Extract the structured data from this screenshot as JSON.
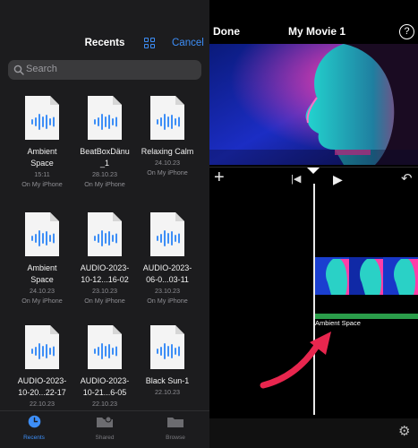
{
  "imovie": {
    "done_label": "Done",
    "title": "My Movie 1",
    "help_icon": "?",
    "audio_clip_label": "Ambient Space",
    "colors": {
      "audio_track": "#2a9d4a"
    }
  },
  "files": {
    "title": "Recents",
    "cancel_label": "Cancel",
    "search_placeholder": "Search",
    "accent": "#3d8ef7",
    "items": [
      {
        "name_line1": "Ambient",
        "name_line2": "Space",
        "meta": "15:11",
        "location": "On My iPhone"
      },
      {
        "name_line1": "BeatBoxDänu",
        "name_line2": "_1",
        "meta": "28.10.23",
        "location": "On My iPhone"
      },
      {
        "name_line1": "Relaxing Calm",
        "name_line2": "",
        "meta": "24.10.23",
        "location": "On My iPhone"
      },
      {
        "name_line1": "Ambient",
        "name_line2": "Space",
        "meta": "24.10.23",
        "location": "On My iPhone"
      },
      {
        "name_line1": "AUDIO-2023-",
        "name_line2": "10-12...16-02",
        "meta": "23.10.23",
        "location": "On My iPhone"
      },
      {
        "name_line1": "AUDIO-2023-",
        "name_line2": "06-0...03-11",
        "meta": "23.10.23",
        "location": "On My iPhone"
      },
      {
        "name_line1": "AUDIO-2023-",
        "name_line2": "10-20...22-17",
        "meta": "22.10.23",
        "location": ""
      },
      {
        "name_line1": "AUDIO-2023-",
        "name_line2": "10-21...6-05",
        "meta": "22.10.23",
        "location": ""
      },
      {
        "name_line1": "Black Sun-1",
        "name_line2": "",
        "meta": "22.10.23",
        "location": ""
      }
    ],
    "tabs": [
      {
        "label": "Recents",
        "icon": "clock-icon",
        "active": true
      },
      {
        "label": "Shared",
        "icon": "shared-folder-icon",
        "active": false
      },
      {
        "label": "Browse",
        "icon": "folder-icon",
        "active": false
      }
    ]
  }
}
